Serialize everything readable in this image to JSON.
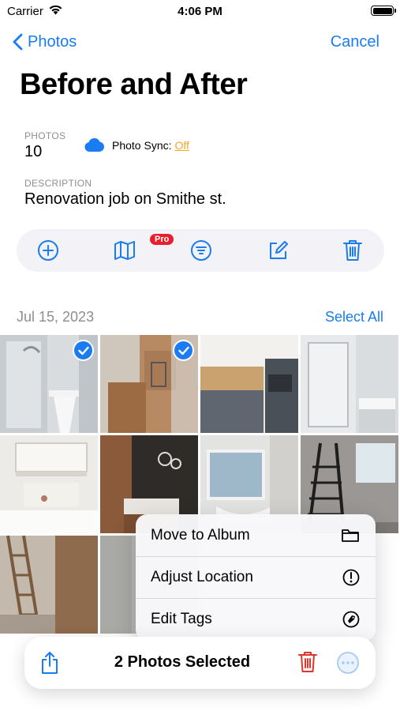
{
  "status_bar": {
    "carrier": "Carrier",
    "time": "4:06 PM",
    "battery_level": 1.0
  },
  "nav": {
    "back_label": "Photos",
    "cancel_label": "Cancel"
  },
  "album": {
    "title": "Before and After",
    "photos_label": "PHOTOS",
    "photos_count": "10",
    "sync_label": "Photo Sync:",
    "sync_value": "Off",
    "description_label": "DESCRIPTION",
    "description": "Renovation job on Smithe st."
  },
  "toolbar": {
    "pro_badge": "Pro",
    "icons": [
      "add-icon",
      "map-icon",
      "filter-icon",
      "edit-icon",
      "trash-icon"
    ]
  },
  "section": {
    "date": "Jul 15, 2023",
    "select_all_label": "Select All"
  },
  "photos": [
    {
      "name": "photo-1",
      "selected": true
    },
    {
      "name": "photo-2",
      "selected": true
    },
    {
      "name": "photo-3",
      "selected": false
    },
    {
      "name": "photo-4",
      "selected": false
    },
    {
      "name": "photo-5",
      "selected": false
    },
    {
      "name": "photo-6",
      "selected": false
    },
    {
      "name": "photo-7",
      "selected": false
    },
    {
      "name": "photo-8",
      "selected": false
    },
    {
      "name": "photo-9",
      "selected": false
    },
    {
      "name": "photo-10",
      "selected": false
    }
  ],
  "context_menu": {
    "items": [
      {
        "label": "Move to Album",
        "icon": "folder-icon"
      },
      {
        "label": "Adjust Location",
        "icon": "location-info-icon"
      },
      {
        "label": "Edit Tags",
        "icon": "tag-icon"
      }
    ]
  },
  "bottom_bar": {
    "title": "2 Photos Selected"
  },
  "colors": {
    "accent": "#1a7cf0",
    "destructive": "#e0352b",
    "sync_off": "#f5a623",
    "pro_badge": "#e8202e"
  }
}
